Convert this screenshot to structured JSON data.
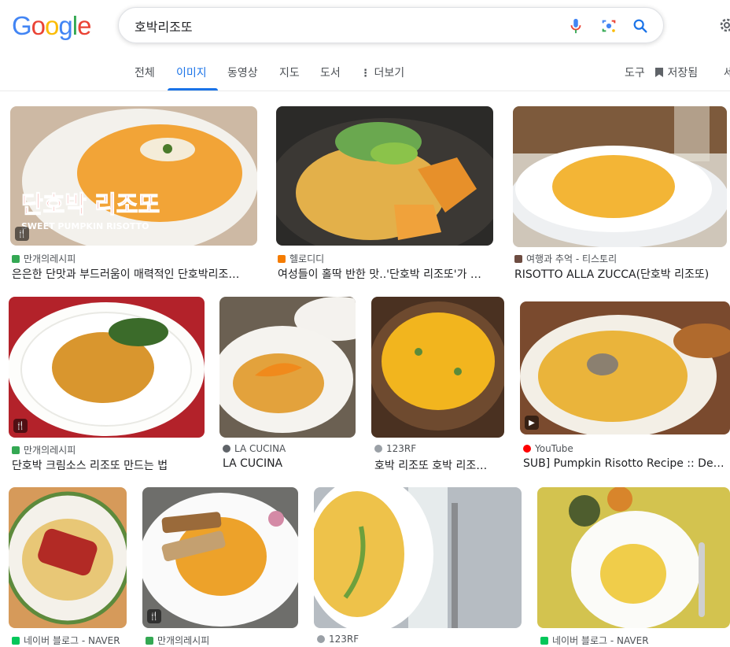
{
  "logo": "Google",
  "search": {
    "query": "호박리조또"
  },
  "tabs": [
    "전체",
    "이미지",
    "동영상",
    "지도",
    "도서",
    "더보기"
  ],
  "tools": {
    "tools_label": "도구",
    "saved_label": "저장됨",
    "safe_label": "세"
  },
  "overlay_text": {
    "korean": "단호박 리조또",
    "english": "SWEET PUMPKIN RISOTTO"
  },
  "results": [
    {
      "source": "만개의레시피",
      "title": "은은한 단맛과 부드러움이 매력적인 단호박리조…",
      "fav_color": "#34a853"
    },
    {
      "source": "헬로디디",
      "title": "여성들이 홀딱 반한 맛..'단호박 리조또'가 …",
      "fav_color": "#f57c00"
    },
    {
      "source": "여행과 추억 - 티스토리",
      "title": "RISOTTO ALLA ZUCCA(단호박 리조또)",
      "fav_color": "#6d4c41"
    },
    {
      "source": "만개의레시피",
      "title": "단호박 크림소스 리조또 만드는 법",
      "fav_color": "#34a853"
    },
    {
      "source": "LA CUCINA",
      "title": "LA CUCINA",
      "fav_color": "#5f6368"
    },
    {
      "source": "123RF",
      "title": "호박 리조또 호박 리조…",
      "fav_color": "#9aa0a6"
    },
    {
      "source": "YouTube",
      "title": "SUB] Pumpkin Risotto Recipe :: Delicio…",
      "fav_color": "#ff0000"
    },
    {
      "source": "네이버 블로그 - NAVER",
      "title": "",
      "fav_color": "#03c75a"
    },
    {
      "source": "만개의레시피",
      "title": "",
      "fav_color": "#34a853"
    },
    {
      "source": "123RF",
      "title": "",
      "fav_color": "#9aa0a6"
    },
    {
      "source": "네이버 블로그 - NAVER",
      "title": "",
      "fav_color": "#03c75a"
    }
  ]
}
